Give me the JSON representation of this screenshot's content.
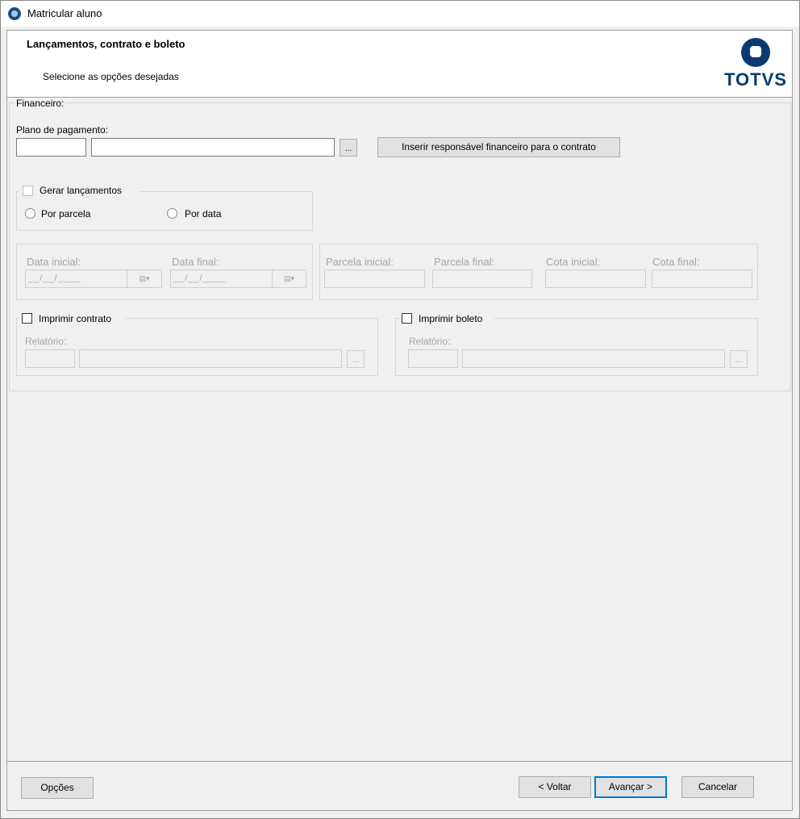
{
  "window": {
    "title": "Matricular aluno"
  },
  "header": {
    "title": "Lançamentos, contrato e boleto",
    "subtitle": "Selecione as opções desejadas",
    "logo_text": "TOTVS"
  },
  "financeiro": {
    "legend": "Financeiro:",
    "plano_label": "Plano de pagamento:",
    "plano_code_value": "",
    "plano_desc_value": "",
    "lookup_label": "...",
    "responsavel_button": "Inserir responsável financeiro para o contrato"
  },
  "lancamentos": {
    "checkbox_label": "Gerar lançamentos",
    "checked": false,
    "radio_parcela": "Por parcela",
    "radio_data": "Por data"
  },
  "datas": {
    "data_inicial_label": "Data inicial:",
    "data_final_label": "Data final:",
    "data_inicial_value": "__/__/____",
    "data_final_value": "__/__/____",
    "calendar_icon": "▤▾"
  },
  "parcelas": {
    "parcela_inicial_label": "Parcela inicial:",
    "parcela_final_label": "Parcela final:",
    "cota_inicial_label": "Cota inicial:",
    "cota_final_label": "Cota final:"
  },
  "contrato": {
    "checkbox_label": "Imprimir contrato",
    "checked": false,
    "relatorio_label": "Relatório:",
    "lookup_label": "..."
  },
  "boleto": {
    "checkbox_label": "Imprimir boleto",
    "checked": false,
    "relatorio_label": "Relatório:",
    "lookup_label": "..."
  },
  "footer": {
    "opcoes": "Opções",
    "voltar": "< Voltar",
    "avancar": "Avançar >",
    "cancelar": "Cancelar"
  },
  "colors": {
    "title_bg": "#ffffff",
    "body_bg": "#f0f0f0",
    "brand": "#0b3a72",
    "focus": "#0078d7"
  }
}
